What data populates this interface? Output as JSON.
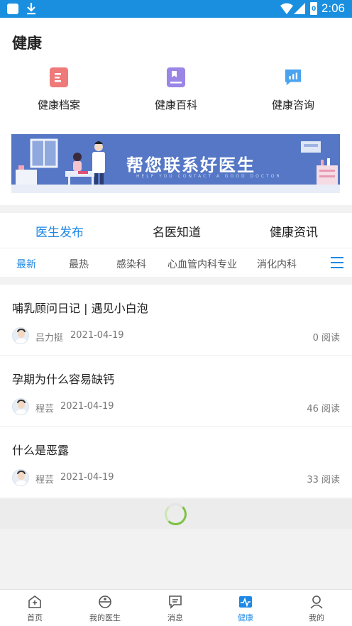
{
  "status_bar": {
    "time": "2:06",
    "battery_glyph": "0"
  },
  "page": {
    "title": "健康"
  },
  "quick_actions": [
    {
      "label": "健康档案",
      "icon": "health-record-icon",
      "color": "#ef7a7a"
    },
    {
      "label": "健康百科",
      "icon": "health-encyclopedia-icon",
      "color": "#9b86e6"
    },
    {
      "label": "健康咨询",
      "icon": "health-consult-icon",
      "color": "#4aa3ef"
    }
  ],
  "banner": {
    "title": "帮您联系好医生",
    "subtitle": "HELP YOU CONTACT A GOOD DOCTOR"
  },
  "tabs": [
    "医生发布",
    "名医知道",
    "健康资讯"
  ],
  "subtabs": [
    "最新",
    "最热",
    "感染科",
    "心血管内科专业",
    "消化内科"
  ],
  "articles": [
    {
      "title": "哺乳顾问日记 | 遇见小白泡",
      "author": "吕力挺",
      "date": "2021-04-19",
      "reads": "0 阅读"
    },
    {
      "title": "孕期为什么容易缺钙",
      "author": "程芸",
      "date": "2021-04-19",
      "reads": "46 阅读"
    },
    {
      "title": "什么是恶露",
      "author": "程芸",
      "date": "2021-04-19",
      "reads": "33 阅读"
    }
  ],
  "bottom_nav": [
    {
      "label": "首页",
      "icon": "home-plus-icon"
    },
    {
      "label": "我的医生",
      "icon": "doctor-icon"
    },
    {
      "label": "消息",
      "icon": "message-icon"
    },
    {
      "label": "健康",
      "icon": "health-pulse-icon"
    },
    {
      "label": "我的",
      "icon": "profile-icon"
    }
  ],
  "colors": {
    "accent": "#1e88e5",
    "status_bar": "#1a8fe0",
    "spinner": "#7cc242"
  }
}
